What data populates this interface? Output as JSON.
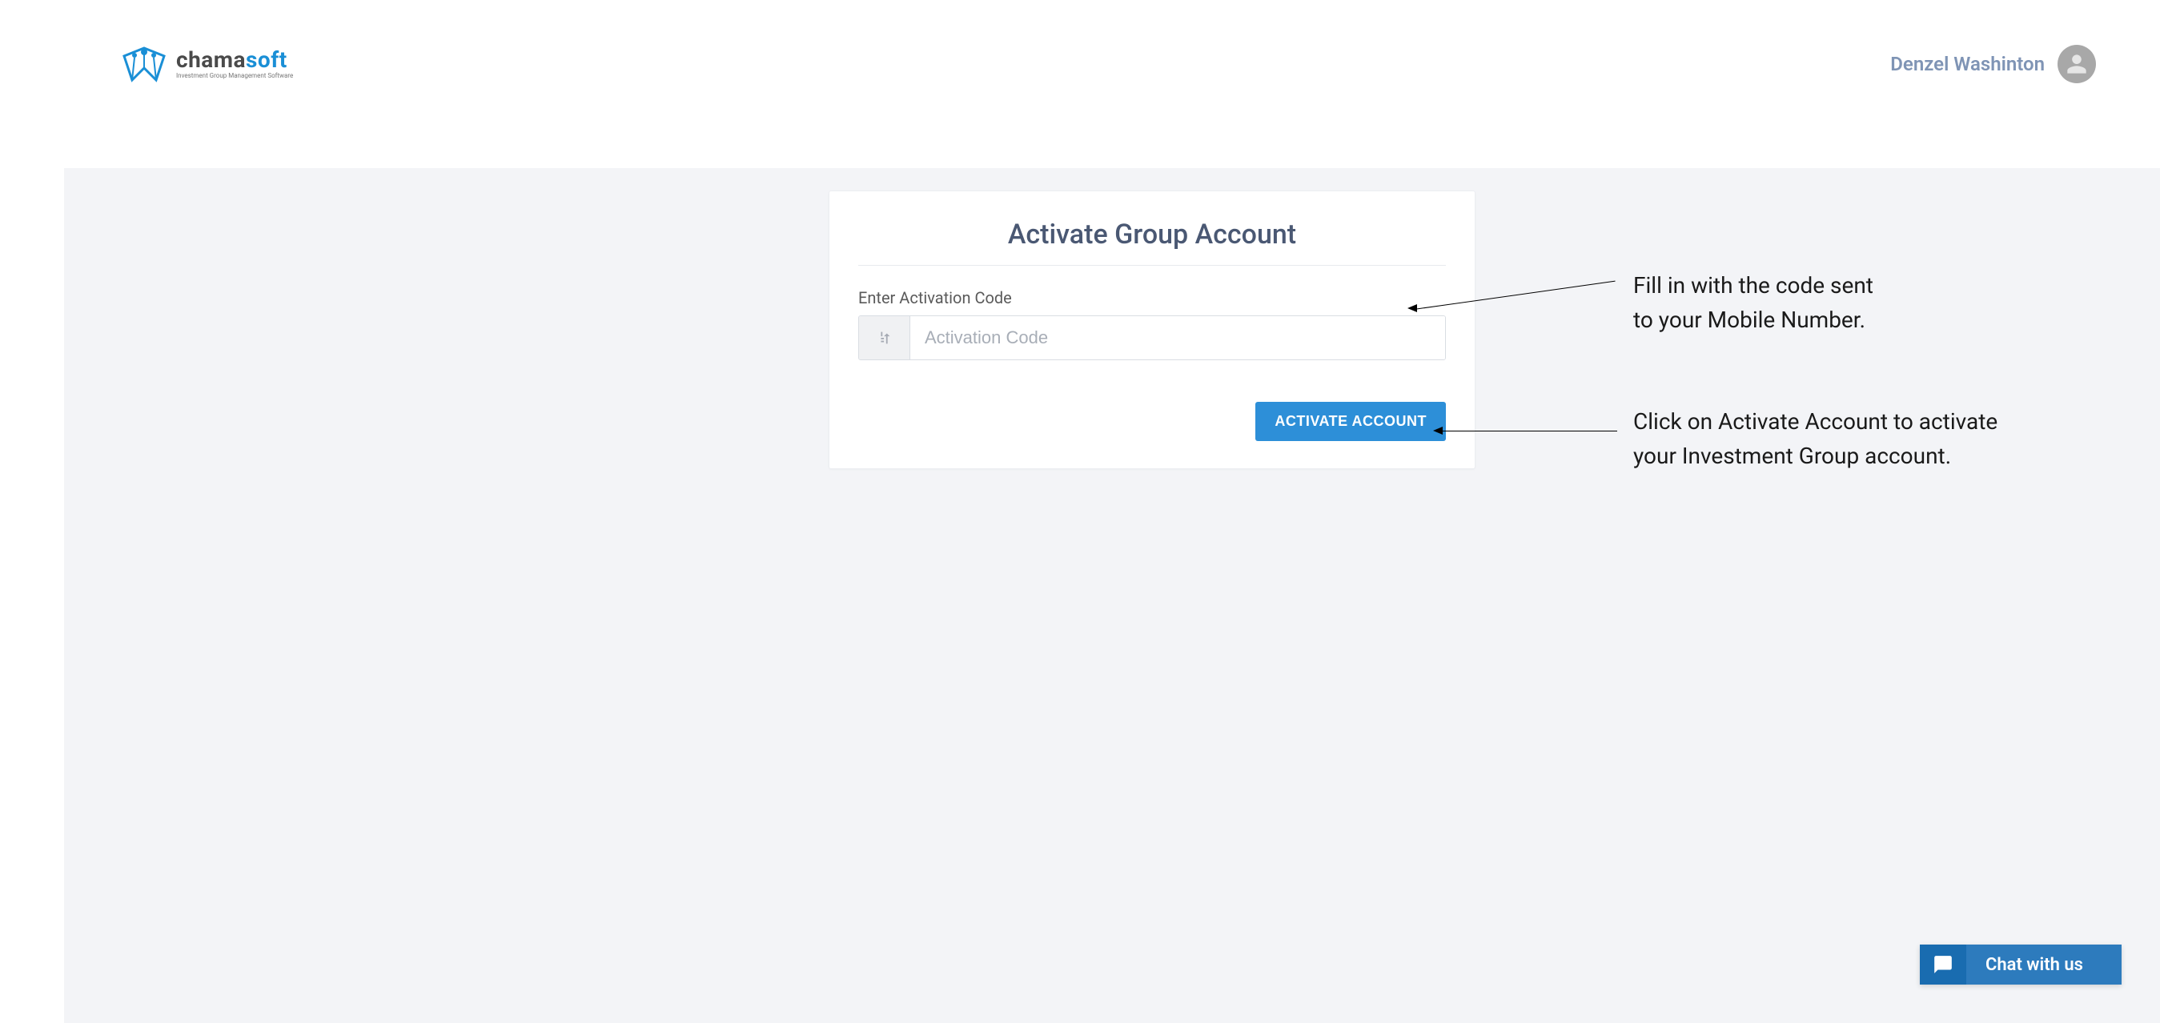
{
  "header": {
    "logo": {
      "text_primary": "chama",
      "text_secondary": "soft",
      "tagline": "Investment Group Management Software"
    },
    "user_name": "Denzel Washinton"
  },
  "card": {
    "title": "Activate Group Account",
    "field_label": "Enter Activation Code",
    "input_placeholder": "Activation Code",
    "button_label": "ACTIVATE ACCOUNT"
  },
  "annotations": {
    "input_note_line1": "Fill in with the code sent",
    "input_note_line2": "to your Mobile Number.",
    "button_note_line1": "Click on Activate Account to activate",
    "button_note_line2": "your Investment Group account."
  },
  "chat": {
    "label": "Chat with us"
  }
}
